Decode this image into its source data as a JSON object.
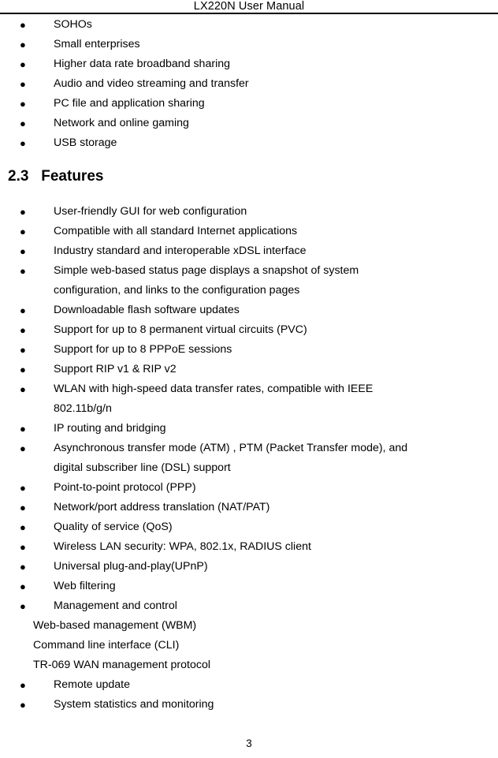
{
  "header": {
    "title": "LX220N User Manual"
  },
  "intro_list": {
    "bullet_glyph": "●",
    "items": [
      {
        "lines": [
          "SOHOs"
        ]
      },
      {
        "lines": [
          "Small enterprises"
        ]
      },
      {
        "lines": [
          "Higher data rate broadband sharing"
        ]
      },
      {
        "lines": [
          "Audio and video streaming and transfer"
        ]
      },
      {
        "lines": [
          "PC file and application sharing"
        ]
      },
      {
        "lines": [
          "Network and online gaming"
        ]
      },
      {
        "lines": [
          "USB storage"
        ]
      }
    ]
  },
  "section": {
    "number": "2.3",
    "title": "Features",
    "heading_text": "2.3   Features"
  },
  "features_list": {
    "bullet_glyph": "●",
    "items": [
      {
        "lines": [
          "User-friendly GUI for web configuration"
        ]
      },
      {
        "lines": [
          "Compatible with all standard Internet applications"
        ]
      },
      {
        "lines": [
          "Industry standard and interoperable xDSL interface"
        ]
      },
      {
        "lines": [
          "Simple web-based status page displays a snapshot of system",
          "configuration, and links to the configuration pages"
        ]
      },
      {
        "lines": [
          "Downloadable flash software updates"
        ]
      },
      {
        "lines": [
          "Support for up to 8 permanent virtual circuits (PVC)"
        ]
      },
      {
        "lines": [
          "Support for up to 8 PPPoE sessions"
        ]
      },
      {
        "lines": [
          "Support RIP v1 & RIP v2"
        ]
      },
      {
        "lines": [
          "WLAN with high-speed data transfer rates, compatible with IEEE",
          "802.11b/g/n"
        ]
      },
      {
        "lines": [
          "IP routing and bridging"
        ]
      },
      {
        "lines": [
          "Asynchronous transfer mode (ATM) , PTM (Packet Transfer mode), and",
          "digital subscriber line (DSL) support"
        ]
      },
      {
        "lines": [
          "Point-to-point protocol (PPP)"
        ]
      },
      {
        "lines": [
          "Network/port address translation (NAT/PAT)"
        ]
      },
      {
        "lines": [
          "Quality of service (QoS)"
        ]
      },
      {
        "lines": [
          "Wireless LAN security: WPA, 802.1x, RADIUS client"
        ]
      },
      {
        "lines": [
          "Universal plug-and-play(UPnP)"
        ]
      },
      {
        "lines": [
          "Web filtering"
        ]
      },
      {
        "lines": [
          "Management and control"
        ]
      }
    ]
  },
  "management_subitems": [
    "Web-based management (WBM)",
    "Command line interface (CLI)",
    "TR-069 WAN management protocol"
  ],
  "features_list_tail": {
    "bullet_glyph": "●",
    "items": [
      {
        "lines": [
          "Remote update"
        ]
      },
      {
        "lines": [
          "System statistics and monitoring"
        ]
      }
    ]
  },
  "footer": {
    "page_number": "3"
  }
}
